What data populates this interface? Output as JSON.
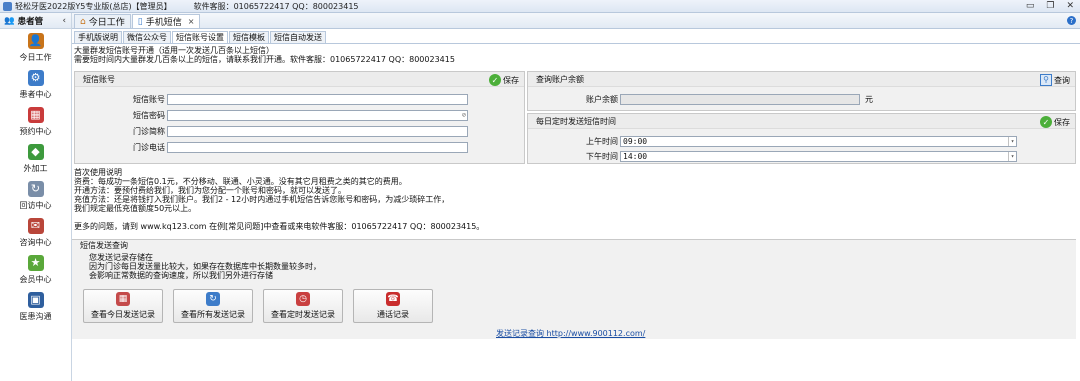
{
  "window": {
    "title": "轻松牙医2022版Y5专业版(总店)【管理员】",
    "hotline": "软件客服：01065722417  QQ：800023415"
  },
  "sidebar": {
    "header": "患者管",
    "items": [
      {
        "label": "今日工作",
        "icon": "today-work-icon",
        "color": "#c8741a"
      },
      {
        "label": "患者中心",
        "icon": "patient-center-icon",
        "color": "#3d7cc9"
      },
      {
        "label": "预约中心",
        "icon": "appointment-icon",
        "color": "#c93b3b"
      },
      {
        "label": "外加工",
        "icon": "outsourcing-icon",
        "color": "#3d9a3d"
      },
      {
        "label": "回访中心",
        "icon": "followup-icon",
        "color": "#7a8ea8"
      },
      {
        "label": "咨询中心",
        "icon": "consult-icon",
        "color": "#b9463a"
      },
      {
        "label": "会员中心",
        "icon": "member-icon",
        "color": "#5aa83a"
      },
      {
        "label": "医患沟通",
        "icon": "communication-icon",
        "color": "#2f5f9e"
      }
    ]
  },
  "tabs": [
    {
      "label": "今日工作",
      "icon": "home-icon",
      "active": false
    },
    {
      "label": "手机短信",
      "icon": "phone-icon",
      "active": true,
      "close": "×"
    }
  ],
  "subtabs": [
    "手机版说明",
    "微信公众号",
    "短信账号设置",
    "短信模板",
    "短信自动发送"
  ],
  "notice": [
    "大量群发短信账号开通（适用一次发送几百条以上短信）",
    "需要短时间内大量群发几百条以上的短信，请联系我们开通。软件客服：01065722417  QQ：800023415"
  ],
  "account_panel": {
    "title": "短信账号",
    "save": "保存",
    "fields": [
      {
        "label": "短信账号",
        "value": ""
      },
      {
        "label": "短信密码",
        "value": ""
      },
      {
        "label": "门诊简称",
        "value": ""
      },
      {
        "label": "门诊电话",
        "value": ""
      }
    ]
  },
  "balance_panel": {
    "title": "查询账户余额",
    "query": "查询",
    "label": "账户余额",
    "value": "",
    "unit": "元"
  },
  "schedule_panel": {
    "title": "每日定时发送短信时间",
    "save": "保存",
    "am_label": "上午时间",
    "am_value": "09:00",
    "pm_label": "下午时间",
    "pm_value": "14:00"
  },
  "instructions": [
    "首次使用说明",
    "资费：每成功一条短信0.1元，不分移动、联通、小灵通。没有其它月租费之类的其它的费用。",
    "开通方法：要预付费给我们，我们为您分配一个账号和密码，就可以发送了。",
    "充值方法：还是将钱打入我们账户。我们2 - 12小时内通过手机短信告诉您账号和密码，为减少琐碎工作，",
    "我们规定最低充值额度50元以上。",
    "",
    "更多的问题，请到 www.kq123.com 在例[常见问题]中查看或来电软件客服：01065722417  QQ：800023415。"
  ],
  "query_section": {
    "title": "短信发送查询",
    "desc": [
      "您发送记录存储在",
      "因为门诊每日发送量比较大，如果存在数据库中长期数量较多时，",
      "会影响正常数据的查询速度，所以我们另外进行存储"
    ],
    "buttons": [
      {
        "label": "查看今日发送记录",
        "icon": "calendar-icon",
        "color": "#c44a4a"
      },
      {
        "label": "查看所有发送记录",
        "icon": "refresh-icon",
        "color": "#3d7cc9"
      },
      {
        "label": "查看定时发送记录",
        "icon": "clock-icon",
        "color": "#c94040"
      },
      {
        "label": "通话记录",
        "icon": "telephone-icon",
        "color": "#c92d2d"
      }
    ],
    "link": "发送记录查询 http://www.900112.com/"
  }
}
